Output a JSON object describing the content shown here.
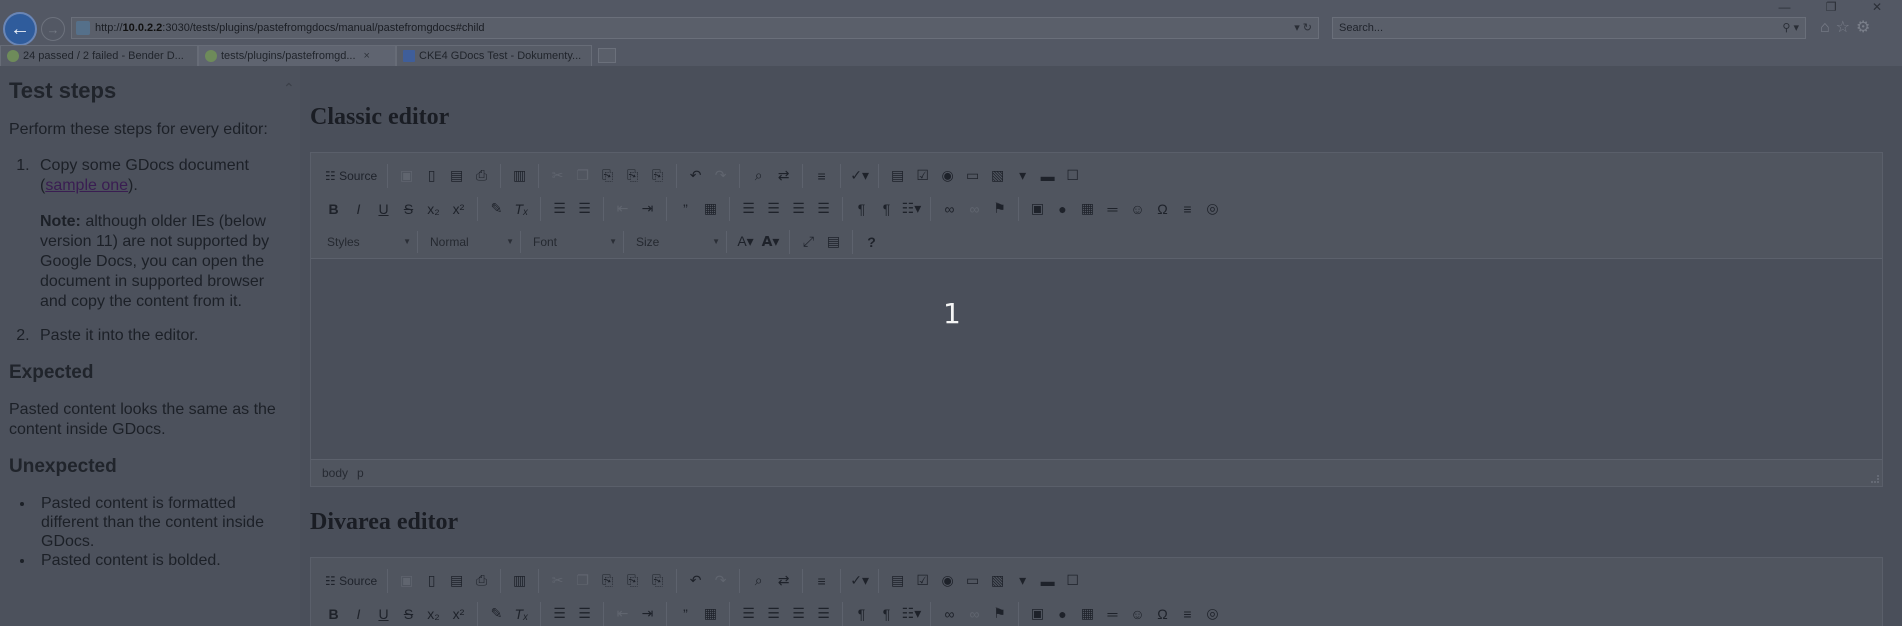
{
  "browser": {
    "url_prefix": "http://",
    "url_host": "10.0.2.2",
    "url_rest": ":3030/tests/plugins/pastefromgdocs/manual/pastefromgdocs#child",
    "search_placeholder": "Search...",
    "url_tools": "▾ ↻",
    "search_tools": "⚲ ▾",
    "tabs": [
      {
        "label": "24 passed / 2 failed - Bender D..."
      },
      {
        "label": "tests/plugins/pastefromgd...",
        "close": "×"
      },
      {
        "label": "CKE4 GDocs Test - Dokumenty..."
      }
    ],
    "window_controls": "— ❐ ✕"
  },
  "sidebar": {
    "title": "Test steps",
    "intro": "Perform these steps for every editor:",
    "steps": [
      {
        "text_before": "Copy some GDocs document (",
        "link": "sample one",
        "text_after": ").",
        "note_label": "Note:",
        "note_text": " although older IEs (below version 11) are not supported by Google Docs, you can open the document in supported browser and copy the content from it."
      },
      {
        "text": "Paste it into the editor."
      }
    ],
    "expected_title": "Expected",
    "expected_text": "Pasted content looks the same as the content inside GDocs.",
    "unexpected_title": "Unexpected",
    "unexpected_items": [
      "Pasted content is formatted different than the content inside GDocs.",
      "Pasted content is bolded."
    ]
  },
  "editors": [
    {
      "title": "Classic editor",
      "source_label": "Source",
      "combos": [
        "Styles",
        "Normal",
        "Font",
        "Size"
      ],
      "marker": "1",
      "status_path": [
        "body",
        "p"
      ]
    },
    {
      "title": "Divarea editor",
      "source_label": "Source"
    }
  ]
}
